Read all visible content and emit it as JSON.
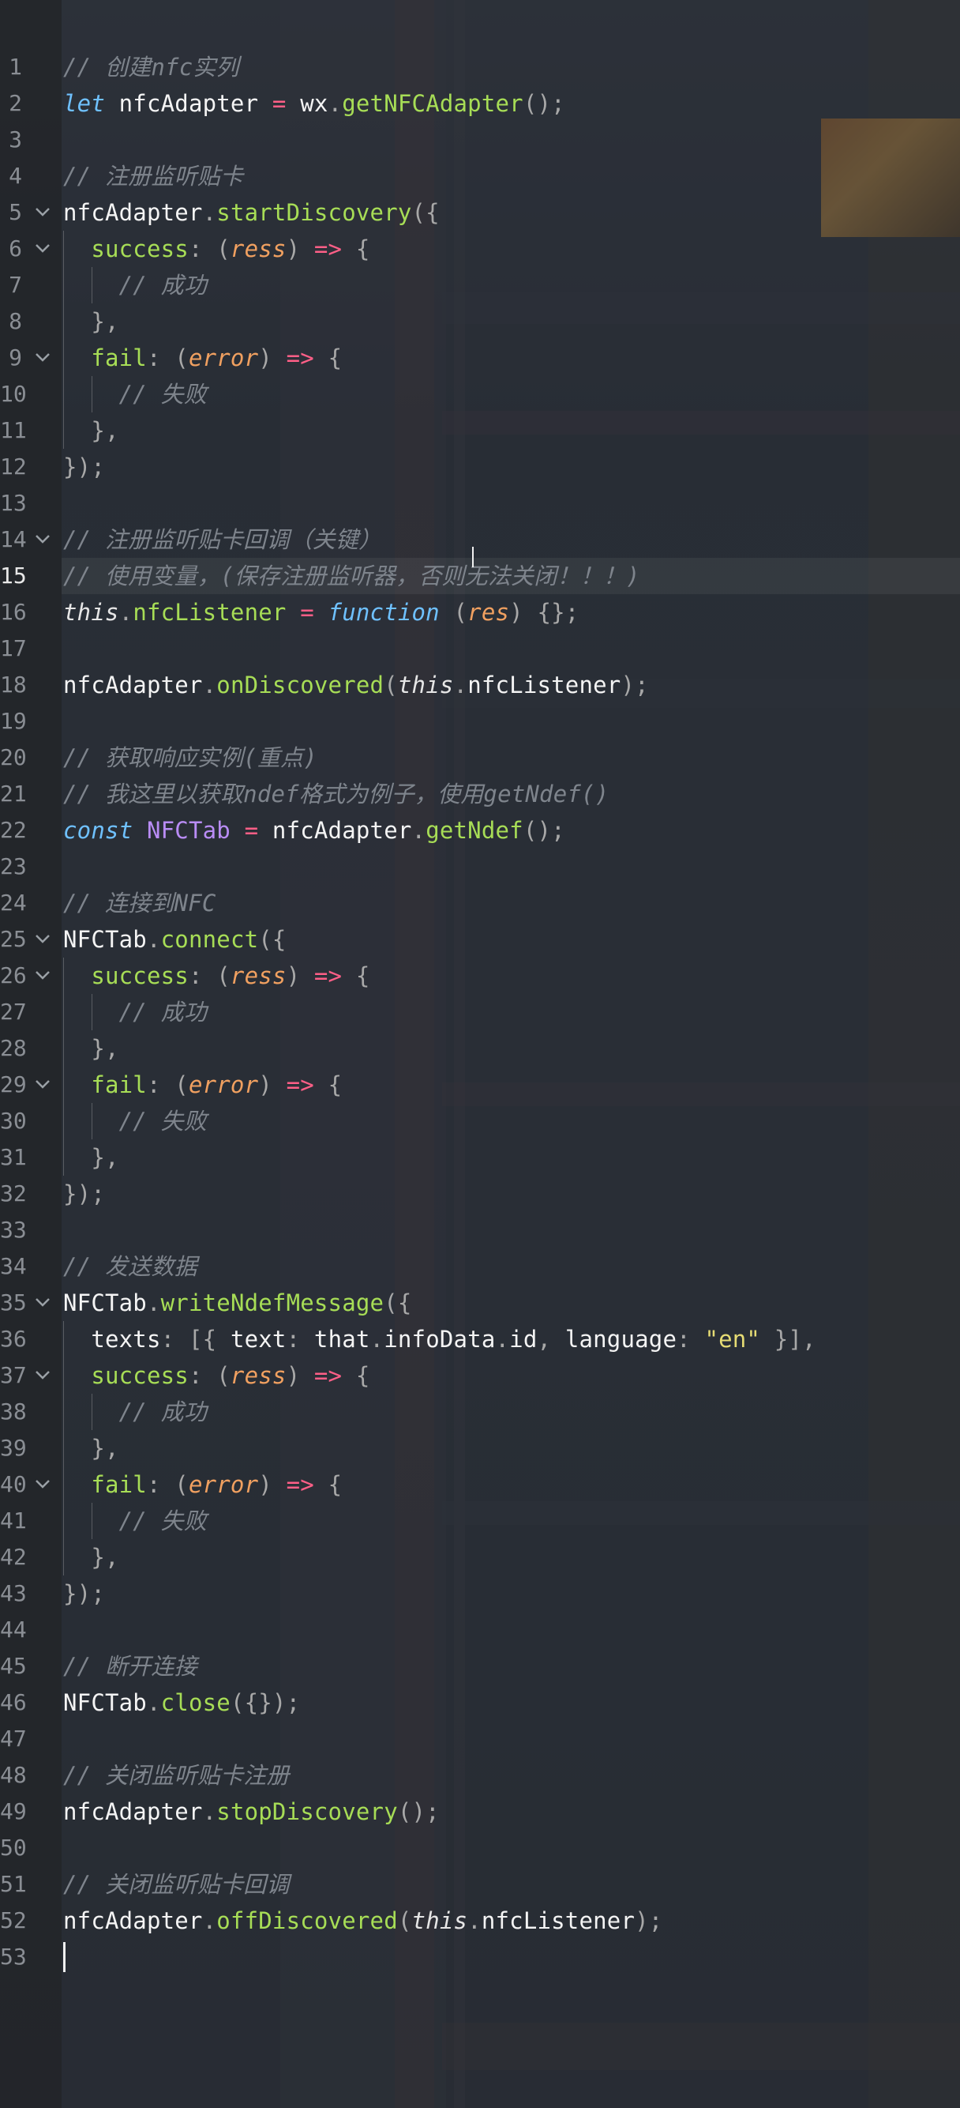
{
  "editor": {
    "active_line": 15,
    "lines": [
      {
        "n": "1",
        "tokens": [
          {
            "t": "// 创建nfc实列",
            "c": "cm"
          }
        ]
      },
      {
        "n": "2",
        "tokens": [
          {
            "t": "let",
            "c": "kw"
          },
          {
            "t": " nfcAdapter ",
            "c": "id"
          },
          {
            "t": "=",
            "c": "op"
          },
          {
            "t": " wx",
            "c": "id"
          },
          {
            "t": ".",
            "c": "punc"
          },
          {
            "t": "getNFCAdapter",
            "c": "fn"
          },
          {
            "t": "();",
            "c": "punc"
          }
        ]
      },
      {
        "n": "3",
        "tokens": []
      },
      {
        "n": "4",
        "tokens": [
          {
            "t": "// 注册监听贴卡",
            "c": "cm"
          }
        ]
      },
      {
        "n": "5",
        "fold": true,
        "tokens": [
          {
            "t": "nfcAdapter",
            "c": "id"
          },
          {
            "t": ".",
            "c": "punc"
          },
          {
            "t": "startDiscovery",
            "c": "fn"
          },
          {
            "t": "({",
            "c": "punc"
          }
        ]
      },
      {
        "n": "6",
        "fold": true,
        "tokens": [
          {
            "t": "  success",
            "c": "prop"
          },
          {
            "t": ": (",
            "c": "punc"
          },
          {
            "t": "ress",
            "c": "par"
          },
          {
            "t": ") ",
            "c": "punc"
          },
          {
            "t": "=>",
            "c": "op"
          },
          {
            "t": " {",
            "c": "punc"
          }
        ]
      },
      {
        "n": "7",
        "tokens": [
          {
            "t": "    // 成功",
            "c": "cm"
          }
        ]
      },
      {
        "n": "8",
        "tokens": [
          {
            "t": "  },",
            "c": "punc"
          }
        ]
      },
      {
        "n": "9",
        "fold": true,
        "tokens": [
          {
            "t": "  fail",
            "c": "prop"
          },
          {
            "t": ": (",
            "c": "punc"
          },
          {
            "t": "error",
            "c": "par"
          },
          {
            "t": ") ",
            "c": "punc"
          },
          {
            "t": "=>",
            "c": "op"
          },
          {
            "t": " {",
            "c": "punc"
          }
        ]
      },
      {
        "n": "10",
        "tokens": [
          {
            "t": "    // 失败",
            "c": "cm"
          }
        ]
      },
      {
        "n": "11",
        "tokens": [
          {
            "t": "  },",
            "c": "punc"
          }
        ]
      },
      {
        "n": "12",
        "tokens": [
          {
            "t": "});",
            "c": "punc"
          }
        ]
      },
      {
        "n": "13",
        "tokens": []
      },
      {
        "n": "14",
        "fold": true,
        "tokens": [
          {
            "t": "// 注册监听贴卡回调（关键）",
            "c": "cm"
          }
        ]
      },
      {
        "n": "15",
        "tokens": [
          {
            "t": "// 使用变量，(保存注册监听器，否则无法关闭！！！)",
            "c": "cm"
          }
        ]
      },
      {
        "n": "16",
        "tokens": [
          {
            "t": "this",
            "c": "this"
          },
          {
            "t": ".",
            "c": "punc"
          },
          {
            "t": "nfcListener",
            "c": "fn"
          },
          {
            "t": " = ",
            "c": "op"
          },
          {
            "t": "function",
            "c": "kw"
          },
          {
            "t": " (",
            "c": "punc"
          },
          {
            "t": "res",
            "c": "par"
          },
          {
            "t": ") {};",
            "c": "punc"
          }
        ]
      },
      {
        "n": "17",
        "tokens": []
      },
      {
        "n": "18",
        "tokens": [
          {
            "t": "nfcAdapter",
            "c": "id"
          },
          {
            "t": ".",
            "c": "punc"
          },
          {
            "t": "onDiscovered",
            "c": "fn"
          },
          {
            "t": "(",
            "c": "punc"
          },
          {
            "t": "this",
            "c": "this"
          },
          {
            "t": ".",
            "c": "punc"
          },
          {
            "t": "nfcListener",
            "c": "id"
          },
          {
            "t": ");",
            "c": "punc"
          }
        ]
      },
      {
        "n": "19",
        "tokens": []
      },
      {
        "n": "20",
        "tokens": [
          {
            "t": "// 获取响应实例(重点)",
            "c": "cm"
          }
        ]
      },
      {
        "n": "21",
        "tokens": [
          {
            "t": "// 我这里以获取ndef格式为例子，使用getNdef()",
            "c": "cm"
          }
        ]
      },
      {
        "n": "22",
        "tokens": [
          {
            "t": "const",
            "c": "kw"
          },
          {
            "t": " NFCTab",
            "c": "cls"
          },
          {
            "t": " = ",
            "c": "op"
          },
          {
            "t": "nfcAdapter",
            "c": "id"
          },
          {
            "t": ".",
            "c": "punc"
          },
          {
            "t": "getNdef",
            "c": "fn"
          },
          {
            "t": "();",
            "c": "punc"
          }
        ]
      },
      {
        "n": "23",
        "tokens": []
      },
      {
        "n": "24",
        "tokens": [
          {
            "t": "// 连接到NFC",
            "c": "cm"
          }
        ]
      },
      {
        "n": "25",
        "fold": true,
        "tokens": [
          {
            "t": "NFCTab",
            "c": "id"
          },
          {
            "t": ".",
            "c": "punc"
          },
          {
            "t": "connect",
            "c": "fn"
          },
          {
            "t": "({",
            "c": "punc"
          }
        ]
      },
      {
        "n": "26",
        "fold": true,
        "tokens": [
          {
            "t": "  success",
            "c": "prop"
          },
          {
            "t": ": (",
            "c": "punc"
          },
          {
            "t": "ress",
            "c": "par"
          },
          {
            "t": ") ",
            "c": "punc"
          },
          {
            "t": "=>",
            "c": "op"
          },
          {
            "t": " {",
            "c": "punc"
          }
        ]
      },
      {
        "n": "27",
        "tokens": [
          {
            "t": "    // 成功",
            "c": "cm"
          }
        ]
      },
      {
        "n": "28",
        "tokens": [
          {
            "t": "  },",
            "c": "punc"
          }
        ]
      },
      {
        "n": "29",
        "fold": true,
        "tokens": [
          {
            "t": "  fail",
            "c": "prop"
          },
          {
            "t": ": (",
            "c": "punc"
          },
          {
            "t": "error",
            "c": "par"
          },
          {
            "t": ") ",
            "c": "punc"
          },
          {
            "t": "=>",
            "c": "op"
          },
          {
            "t": " {",
            "c": "punc"
          }
        ]
      },
      {
        "n": "30",
        "tokens": [
          {
            "t": "    // 失败",
            "c": "cm"
          }
        ]
      },
      {
        "n": "31",
        "tokens": [
          {
            "t": "  },",
            "c": "punc"
          }
        ]
      },
      {
        "n": "32",
        "tokens": [
          {
            "t": "});",
            "c": "punc"
          }
        ]
      },
      {
        "n": "33",
        "tokens": []
      },
      {
        "n": "34",
        "tokens": [
          {
            "t": "// 发送数据",
            "c": "cm"
          }
        ]
      },
      {
        "n": "35",
        "fold": true,
        "tokens": [
          {
            "t": "NFCTab",
            "c": "id"
          },
          {
            "t": ".",
            "c": "punc"
          },
          {
            "t": "writeNdefMessage",
            "c": "fn"
          },
          {
            "t": "({",
            "c": "punc"
          }
        ]
      },
      {
        "n": "36",
        "tokens": [
          {
            "t": "  texts",
            "c": "id"
          },
          {
            "t": ": [{ ",
            "c": "punc"
          },
          {
            "t": "text",
            "c": "id"
          },
          {
            "t": ": ",
            "c": "punc"
          },
          {
            "t": "that",
            "c": "id"
          },
          {
            "t": ".",
            "c": "punc"
          },
          {
            "t": "infoData",
            "c": "id"
          },
          {
            "t": ".",
            "c": "punc"
          },
          {
            "t": "id",
            "c": "id"
          },
          {
            "t": ", ",
            "c": "punc"
          },
          {
            "t": "language",
            "c": "id"
          },
          {
            "t": ": ",
            "c": "punc"
          },
          {
            "t": "\"en\"",
            "c": "str"
          },
          {
            "t": " }],",
            "c": "punc"
          }
        ]
      },
      {
        "n": "37",
        "fold": true,
        "tokens": [
          {
            "t": "  success",
            "c": "prop"
          },
          {
            "t": ": (",
            "c": "punc"
          },
          {
            "t": "ress",
            "c": "par"
          },
          {
            "t": ") ",
            "c": "punc"
          },
          {
            "t": "=>",
            "c": "op"
          },
          {
            "t": " {",
            "c": "punc"
          }
        ]
      },
      {
        "n": "38",
        "tokens": [
          {
            "t": "    // 成功",
            "c": "cm"
          }
        ]
      },
      {
        "n": "39",
        "tokens": [
          {
            "t": "  },",
            "c": "punc"
          }
        ]
      },
      {
        "n": "40",
        "fold": true,
        "tokens": [
          {
            "t": "  fail",
            "c": "prop"
          },
          {
            "t": ": (",
            "c": "punc"
          },
          {
            "t": "error",
            "c": "par"
          },
          {
            "t": ") ",
            "c": "punc"
          },
          {
            "t": "=>",
            "c": "op"
          },
          {
            "t": " {",
            "c": "punc"
          }
        ]
      },
      {
        "n": "41",
        "tokens": [
          {
            "t": "    // 失败",
            "c": "cm"
          }
        ]
      },
      {
        "n": "42",
        "tokens": [
          {
            "t": "  },",
            "c": "punc"
          }
        ]
      },
      {
        "n": "43",
        "tokens": [
          {
            "t": "});",
            "c": "punc"
          }
        ]
      },
      {
        "n": "44",
        "tokens": []
      },
      {
        "n": "45",
        "tokens": [
          {
            "t": "// 断开连接",
            "c": "cm"
          }
        ]
      },
      {
        "n": "46",
        "tokens": [
          {
            "t": "NFCTab",
            "c": "id"
          },
          {
            "t": ".",
            "c": "punc"
          },
          {
            "t": "close",
            "c": "fn"
          },
          {
            "t": "({});",
            "c": "punc"
          }
        ]
      },
      {
        "n": "47",
        "tokens": []
      },
      {
        "n": "48",
        "tokens": [
          {
            "t": "// 关闭监听贴卡注册",
            "c": "cm"
          }
        ]
      },
      {
        "n": "49",
        "tokens": [
          {
            "t": "nfcAdapter",
            "c": "id"
          },
          {
            "t": ".",
            "c": "punc"
          },
          {
            "t": "stopDiscovery",
            "c": "fn"
          },
          {
            "t": "();",
            "c": "punc"
          }
        ]
      },
      {
        "n": "50",
        "tokens": []
      },
      {
        "n": "51",
        "tokens": [
          {
            "t": "// 关闭监听贴卡回调",
            "c": "cm"
          }
        ]
      },
      {
        "n": "52",
        "tokens": [
          {
            "t": "nfcAdapter",
            "c": "id"
          },
          {
            "t": ".",
            "c": "punc"
          },
          {
            "t": "offDiscovered",
            "c": "fn"
          },
          {
            "t": "(",
            "c": "punc"
          },
          {
            "t": "this",
            "c": "this"
          },
          {
            "t": ".",
            "c": "punc"
          },
          {
            "t": "nfcListener",
            "c": "id"
          },
          {
            "t": ");",
            "c": "punc"
          }
        ]
      },
      {
        "n": "53",
        "tokens": []
      }
    ]
  },
  "colors": {
    "comment": "#7e848c",
    "keyword": "#6fc1ff",
    "function": "#a7dd56",
    "param": "#f0a060",
    "operator": "#ff5f87",
    "class": "#b98cf5",
    "string": "#e6dc74"
  },
  "icons": {
    "fold": "chevron-down-icon"
  }
}
